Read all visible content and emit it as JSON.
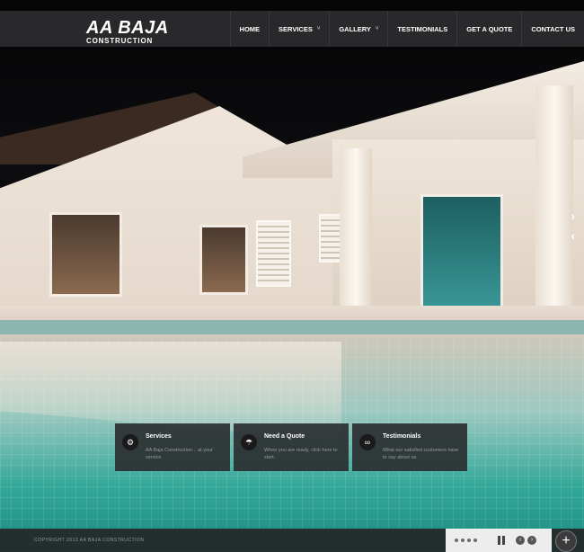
{
  "logo": {
    "line1": "AA BAJA",
    "line2": "CONSTRUCTION"
  },
  "nav": [
    {
      "label": "HOME",
      "dropdown": false
    },
    {
      "label": "SERVICES",
      "dropdown": true
    },
    {
      "label": "GALLERY",
      "dropdown": true
    },
    {
      "label": "TESTIMONIALS",
      "dropdown": false
    },
    {
      "label": "GET A QUOTE",
      "dropdown": false
    },
    {
      "label": "CONTACT US",
      "dropdown": false
    }
  ],
  "features": [
    {
      "icon": "services-icon",
      "title": "Services",
      "text": "AA Baja Construction... at your service"
    },
    {
      "icon": "umbrella-icon",
      "title": "Need a Quote",
      "text": "When you are ready, click here to start."
    },
    {
      "icon": "link-icon",
      "title": "Testimonials",
      "text": "What our satisfied customers have to say about us."
    }
  ],
  "footer": {
    "copyright": "COPYRIGHT 2013 AA BAJA CONSTRUCTION"
  },
  "slider": {
    "slide_count": 4,
    "caret": "˅",
    "plus": "+"
  },
  "colors": {
    "header_bg": "#2d2d30",
    "box_bg": "#28282a",
    "text": "#ffffff",
    "muted": "#9a9a9a"
  }
}
